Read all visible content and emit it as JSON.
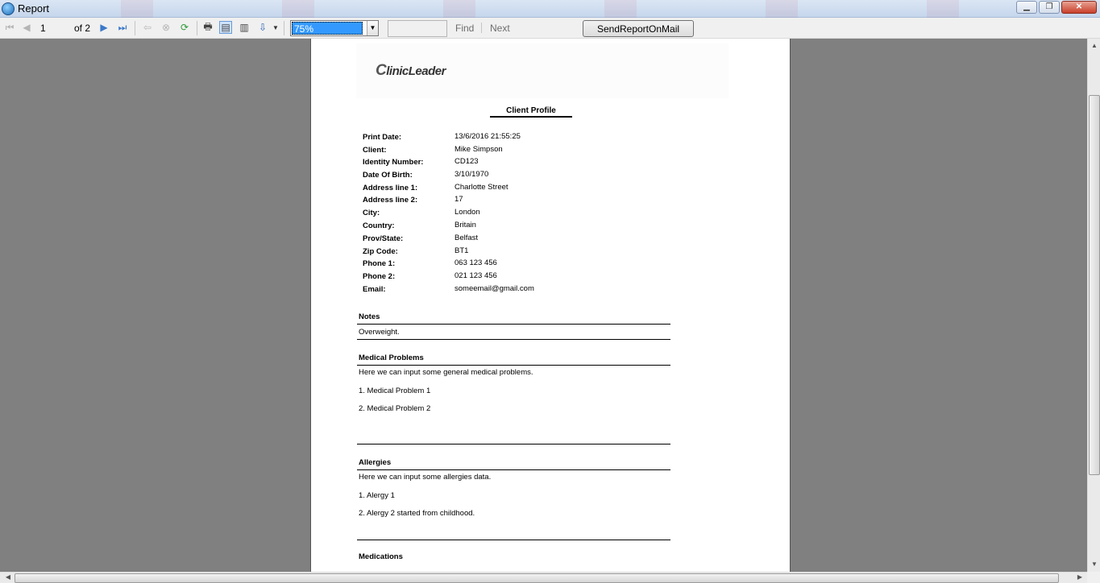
{
  "window": {
    "title": "Report",
    "minimize": "▁",
    "restore": "❐",
    "close": "✕"
  },
  "toolbar": {
    "page_current": "1",
    "page_of": "of 2",
    "zoom": "75%",
    "find_placeholder": "",
    "find_label": "Find",
    "next_label": "Next",
    "send_label": "SendReportOnMail"
  },
  "report": {
    "logo": "linicLeader",
    "logo_initial": "C",
    "title": "Client Profile",
    "fields": [
      {
        "label": "Print Date:",
        "value": "13/6/2016 21:55:25"
      },
      {
        "label": "Client:",
        "value": "Mike Simpson"
      },
      {
        "label": "Identity Number:",
        "value": "CD123"
      },
      {
        "label": "Date Of Birth:",
        "value": "3/10/1970"
      },
      {
        "label": "Address line 1:",
        "value": "Charlotte Street"
      },
      {
        "label": "Address line 2:",
        "value": "17"
      },
      {
        "label": "City:",
        "value": "London"
      },
      {
        "label": "Country:",
        "value": "Britain"
      },
      {
        "label": "Prov/State:",
        "value": "Belfast"
      },
      {
        "label": "Zip Code:",
        "value": "BT1"
      },
      {
        "label": "Phone 1:",
        "value": "063 123 456"
      },
      {
        "label": "Phone 2:",
        "value": "021 123 456"
      },
      {
        "label": "Email:",
        "value": "someemail@gmail.com"
      }
    ],
    "notes": {
      "heading": "Notes",
      "text": "Overweight."
    },
    "medical": {
      "heading": "Medical Problems",
      "intro": "Here we can input some general medical problems.",
      "item1": "1. Medical Problem 1",
      "item2": "2. Medical Problem 2"
    },
    "allergies": {
      "heading": "Allergies",
      "intro": "Here we can input some allergies data.",
      "item1": "1. Alergy 1",
      "item2": "2. Alergy 2 started from childhood."
    },
    "medications": {
      "heading": "Medications"
    }
  }
}
